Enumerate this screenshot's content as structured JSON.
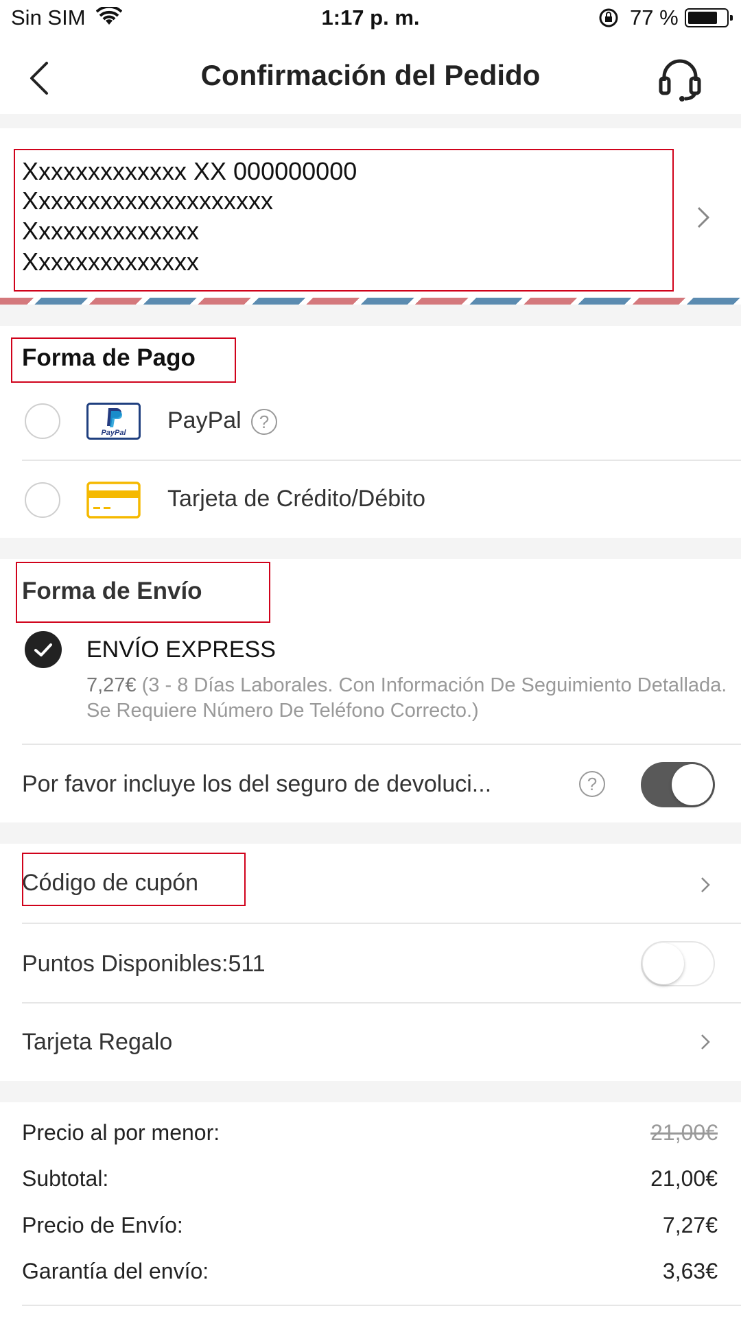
{
  "status_bar": {
    "carrier": "Sin SIM",
    "time": "1:17 p. m.",
    "battery": "77 %",
    "battery_level": 0.77
  },
  "header": {
    "title": "Confirmación del Pedido",
    "back_icon": "chevron-left-icon",
    "support_icon": "headset-icon"
  },
  "address": {
    "lines": [
      "Xxxxxxxxxxxxx XX 000000000",
      "Xxxxxxxxxxxxxxxxxxxx",
      "Xxxxxxxxxxxxxx",
      "Xxxxxxxxxxxxxx"
    ]
  },
  "payment": {
    "title": "Forma de Pago",
    "options": [
      {
        "label": "PayPal",
        "icon": "paypal-icon",
        "help": "?"
      },
      {
        "label": "Tarjeta de Crédito/Débito",
        "icon": "credit-card-icon"
      }
    ]
  },
  "shipping": {
    "title": "Forma de Envío",
    "method": "ENVÍO EXPRESS",
    "price": "7,27€",
    "description": " (3 - 8 Días Laborales. Con Información De Seguimiento Detallada. Se Requiere Número De Teléfono Correcto.)",
    "insurance_label": "Por favor incluye los del seguro de devoluci...",
    "insurance_help": "?",
    "insurance_on": true
  },
  "discounts": {
    "coupon_label": "Código de cupón",
    "points_label": "Puntos Disponibles:",
    "points_value": "511",
    "points_on": false,
    "gift_card_label": "Tarjeta Regalo"
  },
  "summary": {
    "retail_label": "Precio al por menor:",
    "retail_value": "21,00€",
    "subtotal_label": "Subtotal:",
    "subtotal_value": "21,00€",
    "shipping_label": "Precio de Envío:",
    "shipping_value": "7,27€",
    "guarantee_label": "Garantía del envío:",
    "guarantee_value": "3,63€"
  }
}
